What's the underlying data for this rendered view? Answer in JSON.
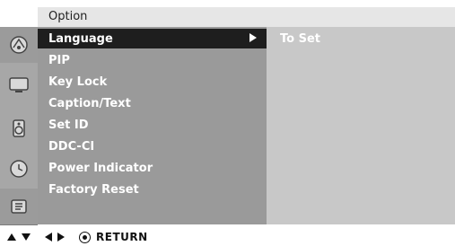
{
  "header": {
    "title": "Option"
  },
  "menu": {
    "items": [
      {
        "label": "Language",
        "selected": true,
        "has_arrow": true
      },
      {
        "label": "PIP"
      },
      {
        "label": "Key Lock"
      },
      {
        "label": "Caption/Text"
      },
      {
        "label": "Set ID"
      },
      {
        "label": "DDC-CI"
      },
      {
        "label": "Power Indicator"
      },
      {
        "label": "Factory Reset"
      }
    ]
  },
  "right_panel": {
    "value": "To Set"
  },
  "footer": {
    "return_label": "RETURN"
  },
  "icons": {
    "rail": [
      "satellite-dish-icon",
      "monitor-icon",
      "speaker-icon",
      "clock-icon",
      "option-icon"
    ],
    "footer": [
      "up-arrow-icon",
      "down-arrow-icon",
      "left-arrow-icon",
      "right-arrow-icon",
      "ok-icon"
    ]
  },
  "colors": {
    "menu_bg": "#9a9a9a",
    "selected_bg": "#1e1e1e",
    "right_panel_bg": "#c8c8c8",
    "header_bg": "#e6e6e6",
    "text_white": "#ffffff"
  }
}
